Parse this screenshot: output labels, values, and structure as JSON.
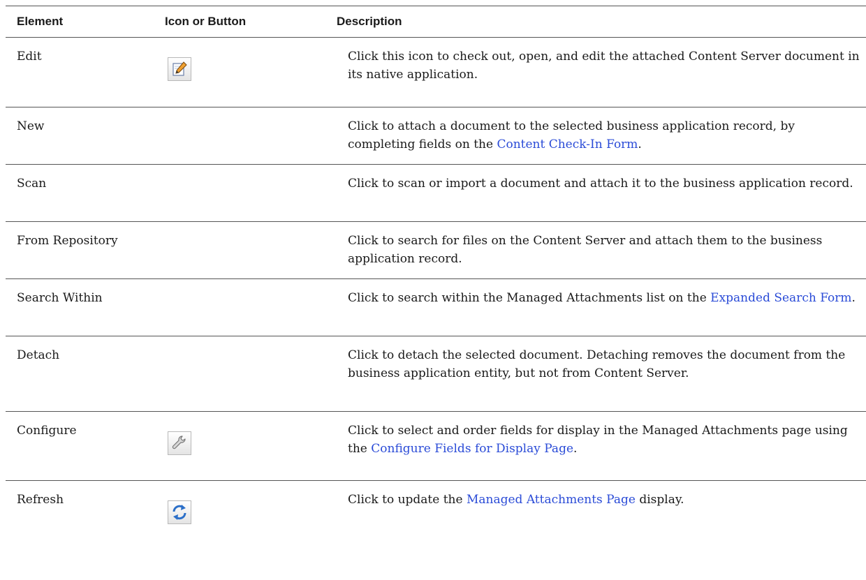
{
  "table": {
    "headers": [
      "Element",
      "Icon or Button",
      "Description"
    ],
    "rows": [
      {
        "element": "Edit",
        "icon": "edit-pencil-icon",
        "desc_pre": "Click this icon to check out, open, and edit the attached Content Server document in its native application.",
        "link": "",
        "desc_post": ""
      },
      {
        "element": "New",
        "icon": "",
        "desc_pre": "Click to attach a document to the selected business application record, by completing fields on the ",
        "link": "Content Check-In Form",
        "desc_post": "."
      },
      {
        "element": "Scan",
        "icon": "",
        "desc_pre": "Click to scan or import a document and attach it to the business application record.",
        "link": "",
        "desc_post": ""
      },
      {
        "element": "From Repository",
        "icon": "",
        "desc_pre": "Click to search for files on the Content Server and attach them to the business application record.",
        "link": "",
        "desc_post": ""
      },
      {
        "element": "Search Within",
        "icon": "",
        "desc_pre": "Click to search within the Managed Attachments list on the ",
        "link": "Expanded Search Form",
        "desc_post": "."
      },
      {
        "element": "Detach",
        "icon": "",
        "desc_pre": "Click to detach the selected document. Detaching removes the document from the business application entity, but not from Content Server.",
        "link": "",
        "desc_post": ""
      },
      {
        "element": "Configure",
        "icon": "wrench-icon",
        "desc_pre": "Click to select and order fields for display in the Managed Attachments page using the ",
        "link": "Configure Fields for Display Page",
        "desc_post": "."
      },
      {
        "element": "Refresh",
        "icon": "refresh-icon",
        "desc_pre": "Click to update the ",
        "link": "Managed Attachments Page",
        "desc_post": " display."
      }
    ]
  },
  "colors": {
    "link": "#2a4bd7",
    "rule": "#555555"
  }
}
